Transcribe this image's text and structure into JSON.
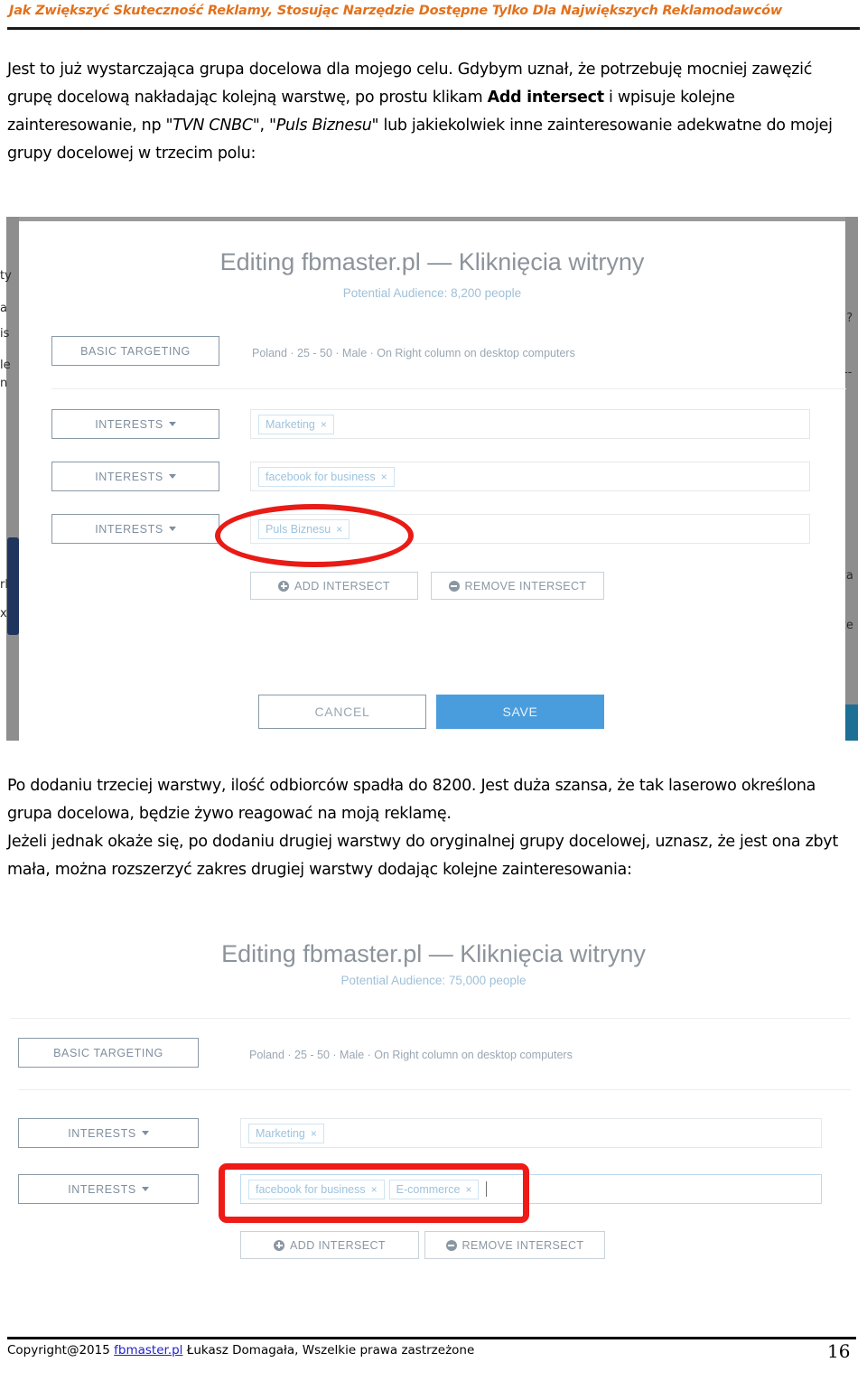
{
  "document": {
    "running_header": "Jak Zwiększyć Skuteczność Reklamy, Stosując Narzędzie Dostępne Tylko Dla Największych Reklamodawców",
    "header_color": "#e2711d",
    "page_number": "16",
    "footer": {
      "copyright_prefix": "Copyright@2015",
      "link_text": "fbmaster.pl",
      "copyright_suffix": "Łukasz Domagała, Wszelkie prawa zastrzeżone"
    }
  },
  "paragraphs": {
    "top": {
      "run_1": "Jest to już wystarczająca grupa docelowa dla mojego celu. Gdybym uznał, że potrzebuję mocniej zawęzić grupę docelową nakładając kolejną warstwę, po prostu klikam ",
      "bold_1": "Add intersect",
      "run_2": " i wpisuje kolejne zainteresowanie, np ",
      "italic_1": "\"TVN CNBC\"",
      "run_3": ", ",
      "italic_2": "\"Puls Biznesu\"",
      "run_4": " lub jakiekolwiek inne zainteresowanie adekwatne do mojej grupy docelowej w trzecim polu:"
    },
    "middle": {
      "line_1": "Po dodaniu trzeciej warstwy, ilość odbiorców spadła do 8200. Jest duża szansa, że tak laserowo określona grupa docelowa, będzie żywo reagować na moją reklamę.",
      "line_2": "Jeżeli jednak okaże się, po dodaniu drugiej warstwy do oryginalnej grupy docelowej, uznasz, że jest ona zbyt mała, można rozszerzyć zakres drugiej warstwy dodając kolejne zainteresowania:"
    }
  },
  "screenshot_one": {
    "title": "Editing fbmaster.pl — Kliknięcia witryny",
    "subtitle": "Potential Audience: 8,200 people",
    "basic_targeting": {
      "button_label": "BASIC TARGETING",
      "summary": "Poland · 25 - 50 · Male · On Right column on desktop computers"
    },
    "interest_rows": [
      {
        "button_label": "INTERESTS",
        "tags": [
          "Marketing"
        ]
      },
      {
        "button_label": "INTERESTS",
        "tags": [
          "facebook for business"
        ]
      },
      {
        "button_label": "INTERESTS",
        "tags": [
          "Puls Biznesu"
        ]
      }
    ],
    "add_intersect_label": "ADD INTERSECT",
    "remove_intersect_label": "REMOVE INTERSECT",
    "cancel_label": "CANCEL",
    "save_label": "SAVE",
    "save_color": "#4a9ddd",
    "annotation": {
      "shape": "ellipse",
      "color": "#e81b16",
      "targets": "Puls Biznesu tag in third INTERESTS field"
    },
    "edge_fragments": {
      "left": [
        "ty",
        "a",
        "is",
        "le",
        "n",
        "rl",
        "x"
      ],
      "right": [
        ") ?",
        "--",
        "za",
        "ze"
      ]
    }
  },
  "screenshot_two": {
    "title": "Editing fbmaster.pl — Kliknięcia witryny",
    "subtitle": "Potential Audience: 75,000 people",
    "basic_targeting": {
      "button_label": "BASIC TARGETING",
      "summary": "Poland · 25 - 50 · Male · On Right column on desktop computers"
    },
    "interest_rows": [
      {
        "button_label": "INTERESTS",
        "tags": [
          "Marketing"
        ]
      },
      {
        "button_label": "INTERESTS",
        "tags": [
          "facebook for business",
          "E-commerce"
        ]
      }
    ],
    "add_intersect_label": "ADD INTERSECT",
    "remove_intersect_label": "REMOVE INTERSECT",
    "annotation": {
      "shape": "rounded-rectangle",
      "color": "#ee1b17",
      "targets": "second INTERESTS field containing facebook for business and E-commerce"
    }
  },
  "icons": {
    "chip_remove": "×",
    "dropdown_caret": "caret-down",
    "add": "plus-circle",
    "remove": "minus-circle"
  }
}
